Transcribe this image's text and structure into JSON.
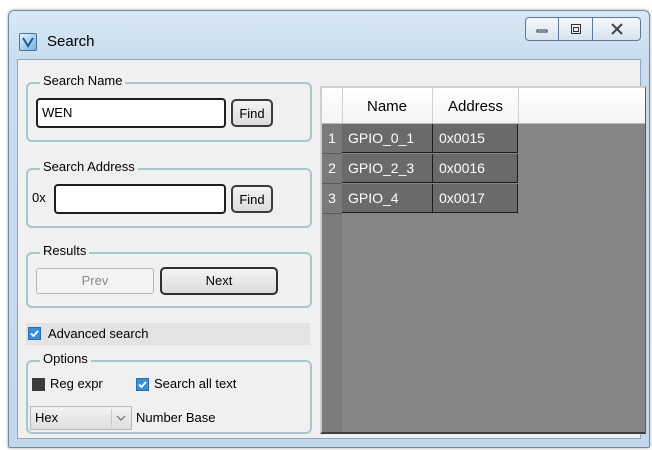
{
  "window": {
    "title": "Search",
    "icon": "search-app-icon",
    "controls": [
      "minimize-icon",
      "maximize-icon",
      "close-icon"
    ]
  },
  "search_name": {
    "group_title": "Search Name",
    "value": "WEN",
    "find_label": "Find"
  },
  "search_address": {
    "group_title": "Search Address",
    "prefix": "0x",
    "value": "",
    "find_label": "Find"
  },
  "results": {
    "group_title": "Results",
    "prev_label": "Prev",
    "next_label": "Next"
  },
  "advanced": {
    "label": "Advanced search",
    "checked": true
  },
  "options": {
    "group_title": "Options",
    "reg_expr_label": "Reg expr",
    "reg_expr_checked": false,
    "search_all_label": "Search all text",
    "search_all_checked": true,
    "number_base_value": "Hex",
    "number_base_label": "Number Base"
  },
  "table": {
    "columns": [
      "Name",
      "Address"
    ],
    "rows": [
      {
        "num": "1",
        "name": "GPIO_0_1",
        "address": "0x0015"
      },
      {
        "num": "2",
        "name": "GPIO_2_3",
        "address": "0x0016"
      },
      {
        "num": "3",
        "name": "GPIO_4",
        "address": "0x0017"
      }
    ]
  },
  "colors": {
    "accent": "#3a8ed6",
    "group_border": "#a8c6cc",
    "table_bg": "#868686"
  }
}
